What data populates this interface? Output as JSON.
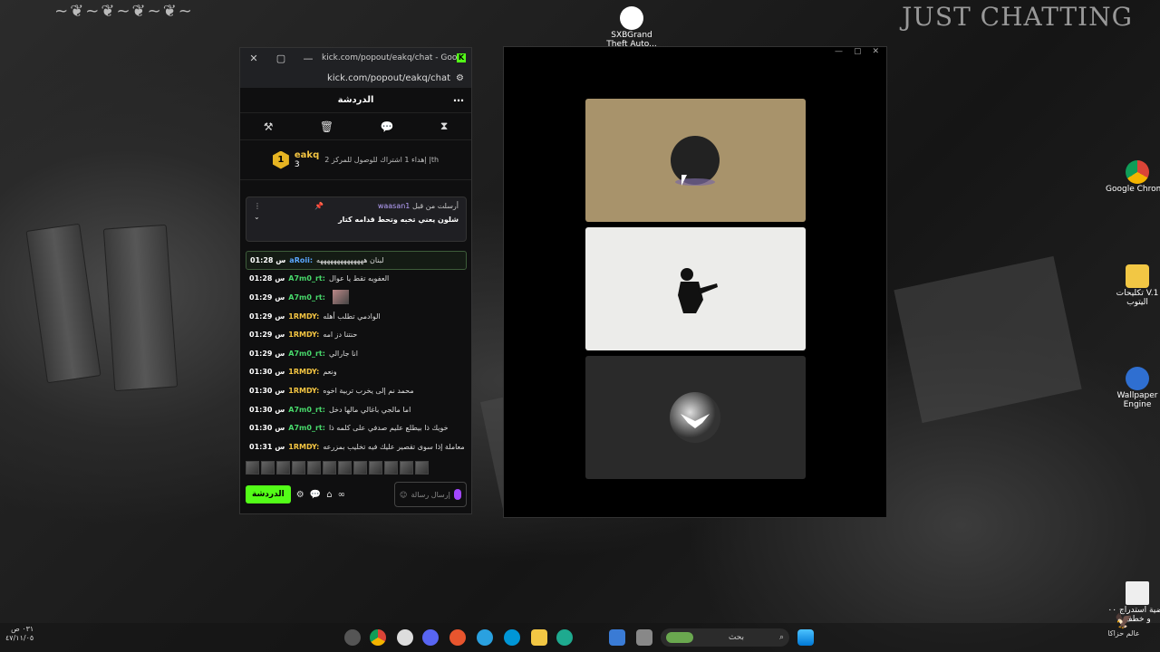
{
  "desktop": {
    "watermark": "JUST CHATTING",
    "icons": [
      {
        "label": "SXBGrand Theft Auto...",
        "icon": "gta-shortcut-icon"
      },
      {
        "label": "Google Chrome",
        "icon": "chrome-icon"
      },
      {
        "label": "تكليحات V.1 اليتوب",
        "icon": "folder-icon"
      },
      {
        "label": "Wallpaper Engine",
        "icon": "wallpaper-engine-icon"
      },
      {
        "label": "قضية استدراج ٠٠ و خطف",
        "icon": "document-icon"
      },
      {
        "label": "عالم حزاكا",
        "icon": "eagle-logo-icon"
      }
    ],
    "colors": {
      "accent_green": "#53fc18",
      "username_gold": "#f4c542",
      "username_green": "#48d96b",
      "username_blue": "#5aa6ff"
    }
  },
  "chat_window": {
    "title": "kick.com/popout/eakq/chat - Google C...",
    "url": "kick.com/popout/eakq/chat",
    "header": "الدردشة",
    "goal": {
      "username": "eakq",
      "badge": "1",
      "count": "3",
      "text": "إهداء 1 اشتراك للوصول للمركز 2 |th"
    },
    "pinned": {
      "label": "أرسلت من قبل",
      "username": "waasan1",
      "text": "شلون يعني تخبه وتحط قدامه كتار"
    },
    "messages": [
      {
        "time": "01:28 س",
        "user": "aRoii:",
        "text": "لبنان ههههههههههههههه",
        "color": "#5aa6ff",
        "highlight": true
      },
      {
        "time": "01:28 س",
        "user": "A7m0_rt:",
        "text": "العفويه تقط يا عوال",
        "color": "#48d96b"
      },
      {
        "time": "01:29 س",
        "user": "A7m0_rt:",
        "text": "",
        "color": "#48d96b"
      },
      {
        "time": "01:29 س",
        "user": "1RMDY:",
        "text": "الوادمي تطلب أهله",
        "color": "#f4c542"
      },
      {
        "time": "01:29 س",
        "user": "1RMDY:",
        "text": "حنتنا دز امه",
        "color": "#f4c542"
      },
      {
        "time": "01:29 س",
        "user": "A7m0_rt:",
        "text": "انا جارالي",
        "color": "#48d96b"
      },
      {
        "time": "01:30 س",
        "user": "1RMDY:",
        "text": "ونعم",
        "color": "#f4c542"
      },
      {
        "time": "01:30 س",
        "user": "1RMDY:",
        "text": "محمد نم إلى يخرب تربية اخوه",
        "color": "#f4c542"
      },
      {
        "time": "01:30 س",
        "user": "A7m0_rt:",
        "text": "اما مالجي باغالي مالها دخل",
        "color": "#48d96b"
      },
      {
        "time": "01:30 س",
        "user": "A7m0_rt:",
        "text": "خويك ذا بيطلع عليم صدفي على كلمه ذا",
        "color": "#48d96b"
      },
      {
        "time": "01:31 س",
        "user": "1RMDY:",
        "text": "ذي معاملة إذا سوى تقصير عليك فيه تخليب بمزرعه",
        "color": "#f4c542"
      }
    ],
    "input_placeholder": "إرسال رسالة",
    "chat_button": "الدردشة"
  },
  "media_window": {
    "cards": [
      "dark-cat-emblem",
      "silhouette-figure",
      "eagle-moon-emblem"
    ]
  },
  "taskbar": {
    "search_placeholder": "بحث",
    "time": "٠٣١ ص",
    "date": "٤٧/١١/٠٥"
  }
}
